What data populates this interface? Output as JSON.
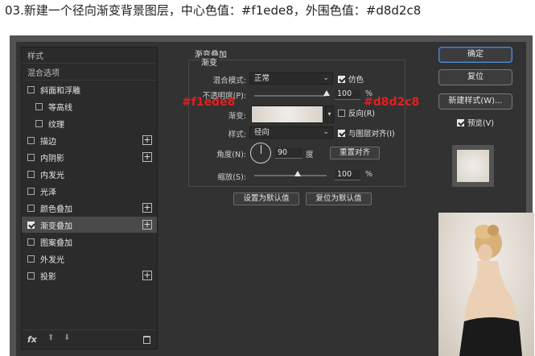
{
  "caption": "03.新建一个径向渐变背景图层，中心色值：#f1ede8，外围色值：#d8d2c8",
  "left_panel": {
    "items": [
      {
        "label": "样式",
        "type": "header"
      },
      {
        "label": "混合选项",
        "type": "header"
      },
      {
        "label": "斜面和浮雕",
        "checked": false,
        "plus": false,
        "indent": false
      },
      {
        "label": "等高线",
        "checked": false,
        "plus": false,
        "indent": true
      },
      {
        "label": "纹理",
        "checked": false,
        "plus": false,
        "indent": true
      },
      {
        "label": "描边",
        "checked": false,
        "plus": true,
        "indent": false
      },
      {
        "label": "内阴影",
        "checked": false,
        "plus": true,
        "indent": false
      },
      {
        "label": "内发光",
        "checked": false,
        "plus": false,
        "indent": false
      },
      {
        "label": "光泽",
        "checked": false,
        "plus": false,
        "indent": false
      },
      {
        "label": "颜色叠加",
        "checked": false,
        "plus": true,
        "indent": false
      },
      {
        "label": "渐变叠加",
        "checked": true,
        "plus": true,
        "indent": false,
        "active": true
      },
      {
        "label": "图案叠加",
        "checked": false,
        "plus": false,
        "indent": false
      },
      {
        "label": "外发光",
        "checked": false,
        "plus": false,
        "indent": false
      },
      {
        "label": "投影",
        "checked": false,
        "plus": true,
        "indent": false
      }
    ],
    "footer": {
      "fx": "fx",
      "up": "⬆",
      "down": "⬇"
    }
  },
  "gradient_overlay": {
    "section_title": "渐变叠加",
    "group_title": "渐变",
    "blend_mode_label": "混合模式:",
    "blend_mode_value": "正常",
    "dither_label": "仿色",
    "dither_checked": true,
    "opacity_label": "不透明度(P):",
    "opacity_value": "100",
    "opacity_percent": 100,
    "percent_sign": "%",
    "gradient_label": "渐变:",
    "reverse_label": "反向(R)",
    "reverse_checked": false,
    "style_label": "样式:",
    "style_value": "径向",
    "align_label": "与图层对齐(I)",
    "align_checked": true,
    "angle_label": "角度(N):",
    "angle_value": "90",
    "angle_unit": "度",
    "reset_align_button": "重置对齐",
    "scale_label": "缩放(S):",
    "scale_value": "100",
    "scale_percent": 100,
    "set_default_button": "设置为默认值",
    "reset_default_button": "复位为默认值",
    "center_color_annotation": "#f1ede8",
    "outer_color_annotation": "#d8d2c8"
  },
  "right_panel": {
    "ok_button": "确定",
    "reset_button": "复位",
    "new_style_button": "新建样式(W)...",
    "preview_label": "预览(V)",
    "preview_checked": true
  },
  "colors": {
    "center": "#f1ede8",
    "outer": "#d8d2c8",
    "annotation": "#e02020",
    "accent": "#4f8bd6"
  }
}
